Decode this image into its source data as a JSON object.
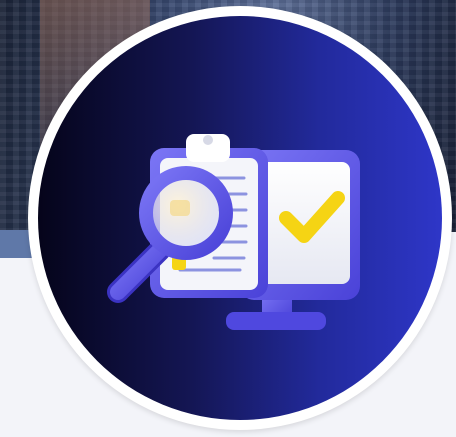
{
  "badge": {
    "icon": "document-review-icon",
    "elements": [
      "clipboard-icon",
      "magnifier-icon",
      "monitor-icon",
      "checkmark-icon"
    ]
  },
  "colors": {
    "disc_start": "#05041a",
    "disc_end": "#2e36c8",
    "ring": "#ffffff",
    "accent_purple": "#5b55e6",
    "checkmark_yellow": "#f5d414",
    "panel_white": "#f4f5fa"
  }
}
